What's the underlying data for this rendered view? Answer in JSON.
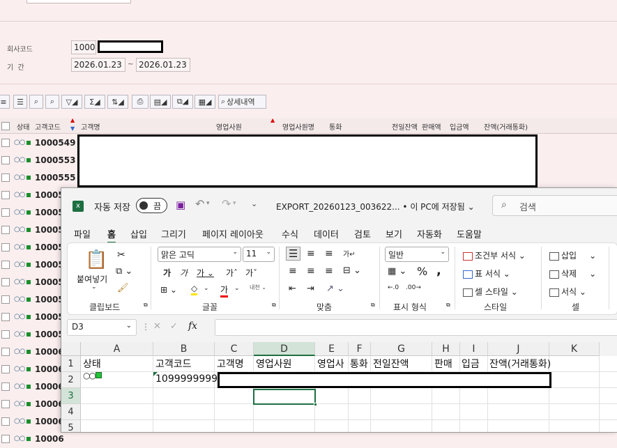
{
  "erp": {
    "fields": {
      "company_code_label": "회사코드",
      "company_code_value": "1000",
      "period_label": "기  간",
      "period_from": "2026.01.23",
      "period_sep": "~",
      "period_to": "2026.01.23"
    },
    "toolbar": {
      "detail_label": "상세내역"
    },
    "columns": [
      "상태",
      "고객코드",
      "고객명",
      "영업사원",
      "영업사원명",
      "통화",
      "전일잔액",
      "판매액",
      "입금액",
      "잔액(거래통화)"
    ],
    "rows": [
      "1000549",
      "1000553",
      "1000555",
      "10005",
      "10005",
      "10005",
      "10005",
      "10005",
      "10005",
      "10005",
      "10005",
      "10005",
      "10006",
      "10006",
      "10006",
      "10006",
      "10006",
      "10006"
    ]
  },
  "excel": {
    "autosave_label": "자동 저장",
    "autosave_state": "끔",
    "file_title": "EXPORT_20260123_003622... • 이 PC에 저장됨",
    "search_placeholder": "검색",
    "menu": [
      "파일",
      "홈",
      "삽입",
      "그리기",
      "페이지 레이아웃",
      "수식",
      "데이터",
      "검토",
      "보기",
      "자동화",
      "도움말"
    ],
    "ribbon": {
      "paste": "붙여넣기",
      "clipboard": "클립보드",
      "font_name": "맑은 고딕",
      "font_size": "11",
      "font_group": "글꼴",
      "align_group": "맞춤",
      "number_format": "일반",
      "number_group": "표시 형식",
      "conditional": "조건부 서식",
      "table_format": "표 서식",
      "cell_style": "셀 스타일",
      "style_group": "스타일",
      "insert": "삽입",
      "delete": "삭제",
      "format": "서식",
      "cells_group": "셀"
    },
    "name_box": "D3",
    "fx": "fx",
    "col_headers": [
      "A",
      "B",
      "C",
      "D",
      "E",
      "F",
      "G",
      "H",
      "I",
      "J",
      "K"
    ],
    "row_headers": [
      "1",
      "2",
      "3",
      "4",
      "5"
    ],
    "header_row": [
      "상태",
      "고객코드",
      "고객명",
      "영업사원",
      "영업사",
      "통화",
      "전일잔액",
      "판매",
      "입금",
      "잔액(거래통화)"
    ],
    "row2_status": "○○■",
    "row2_code": "1099999999"
  }
}
